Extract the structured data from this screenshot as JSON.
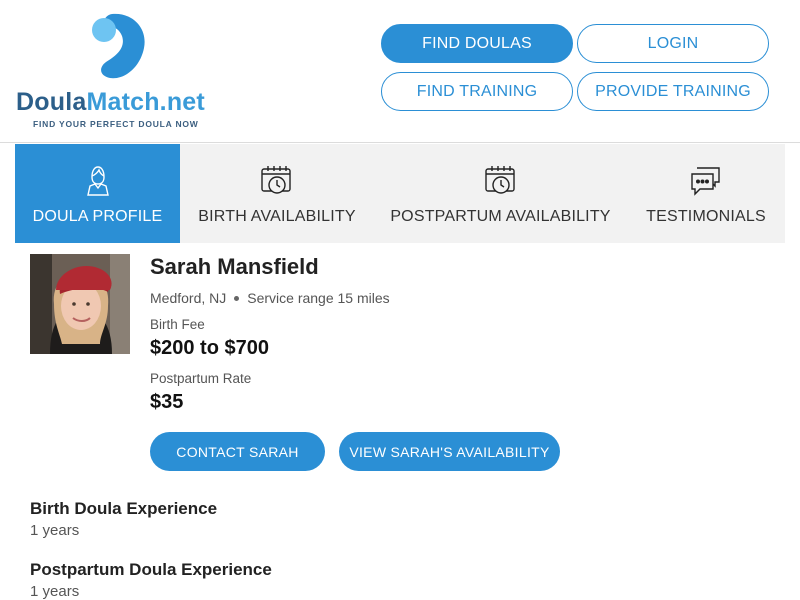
{
  "brand": {
    "name_part1": "Doula",
    "name_part2": "Match.net",
    "tagline": "FIND YOUR PERFECT DOULA NOW",
    "colors": {
      "primary": "#2b8fd5",
      "logo_light": "#6ec4f2",
      "logo_dark": "#2c5f8a"
    }
  },
  "header": {
    "find_doulas": "FIND DOULAS",
    "login": "LOGIN",
    "find_training": "FIND TRAINING",
    "provide_training": "PROVIDE TRAINING"
  },
  "tabs": [
    {
      "label": "DOULA PROFILE",
      "icon": "person-icon",
      "active": true
    },
    {
      "label": "BIRTH AVAILABILITY",
      "icon": "calendar-clock-icon",
      "active": false
    },
    {
      "label": "POSTPARTUM AVAILABILITY",
      "icon": "calendar-clock-icon",
      "active": false
    },
    {
      "label": "TESTIMONIALS",
      "icon": "chat-bubbles-icon",
      "active": false
    }
  ],
  "profile": {
    "name": "Sarah Mansfield",
    "location": "Medford, NJ",
    "service_range": "Service range 15 miles",
    "birth_fee_label": "Birth Fee",
    "birth_fee": "$200 to $700",
    "postpartum_rate_label": "Postpartum Rate",
    "postpartum_rate": "$35",
    "contact_button": "CONTACT SARAH",
    "availability_button": "VIEW SARAH'S AVAILABILITY"
  },
  "experience": {
    "birth_title": "Birth Doula Experience",
    "birth_value": "1 years",
    "postpartum_title": "Postpartum Doula Experience",
    "postpartum_value": "1 years"
  }
}
